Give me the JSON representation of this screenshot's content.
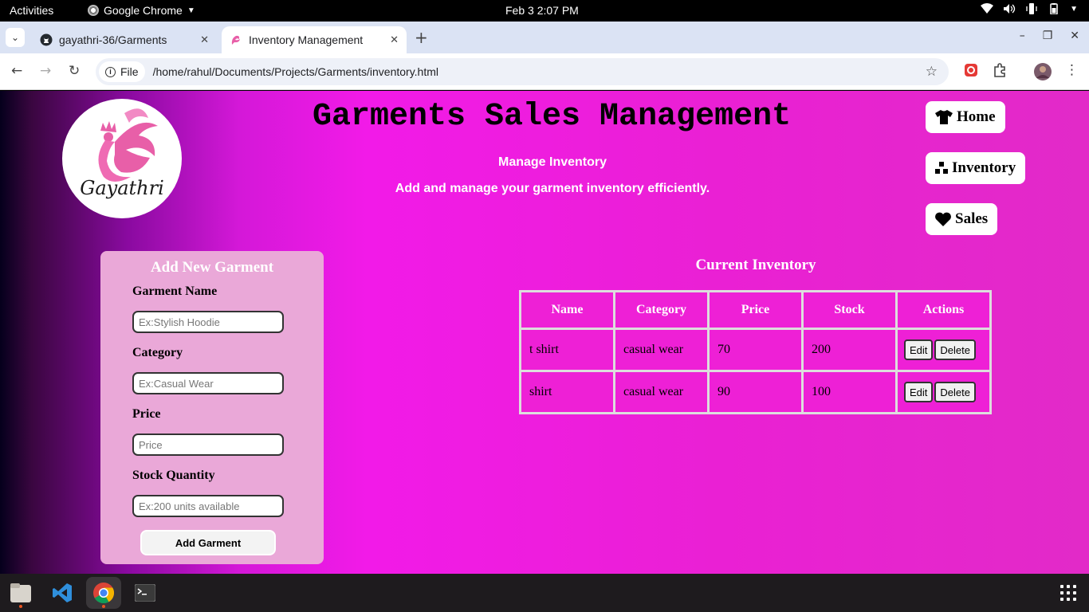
{
  "system": {
    "activities": "Activities",
    "app_name": "Google Chrome",
    "clock": "Feb 3  2:07 PM"
  },
  "browser": {
    "tabs": [
      {
        "title": "gayathri-36/Garments",
        "icon": "github-icon"
      },
      {
        "title": "Inventory Management",
        "icon": "peacock-favicon-icon",
        "active": true
      }
    ],
    "omnibox": {
      "chip_label": "File",
      "url": "/home/rahul/Documents/Projects/Garments/inventory.html"
    }
  },
  "page": {
    "logo_text": "Gayathri",
    "title": "Garments Sales Management",
    "subtitle": "Manage Inventory",
    "tagline": "Add and manage your garment inventory efficiently.",
    "nav": [
      {
        "label": "Home",
        "icon": "tshirt-icon"
      },
      {
        "label": "Inventory",
        "icon": "boxes-icon"
      },
      {
        "label": "Sales",
        "icon": "heart-icon"
      }
    ],
    "form": {
      "heading": "Add New Garment",
      "name_label": "Garment Name",
      "name_placeholder": "Ex:Stylish Hoodie",
      "category_label": "Category",
      "category_placeholder": "Ex:Casual Wear",
      "price_label": "Price",
      "price_placeholder": "Price",
      "stock_label": "Stock Quantity",
      "stock_placeholder": "Ex:200 units available",
      "submit_label": "Add Garment"
    },
    "inventory": {
      "heading": "Current Inventory",
      "columns": [
        "Name",
        "Category",
        "Price",
        "Stock",
        "Actions"
      ],
      "rows": [
        {
          "name": "t shirt",
          "category": "casual wear",
          "price": "70",
          "stock": "200"
        },
        {
          "name": "shirt",
          "category": "casual wear",
          "price": "90",
          "stock": "100"
        }
      ],
      "edit_label": "Edit",
      "delete_label": "Delete"
    },
    "colors": {
      "background_main": "#f21ae8",
      "form_card": "#eaa8d8",
      "table_cell": "#ee20d6"
    }
  }
}
